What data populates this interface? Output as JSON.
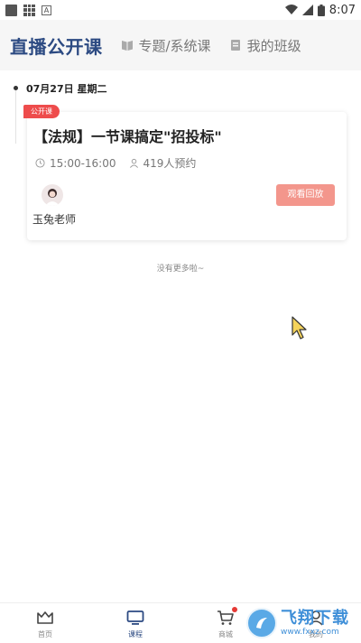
{
  "status_bar": {
    "time": "8:07"
  },
  "header": {
    "title": "直播公开课",
    "tabs": [
      {
        "label": "专题/系统课",
        "icon": "book-icon"
      },
      {
        "label": "我的班级",
        "icon": "notebook-icon"
      }
    ]
  },
  "timeline": {
    "date": "07月27日 星期二"
  },
  "course_card": {
    "badge": "公开课",
    "title": "【法规】一节课搞定\"招投标\"",
    "time": "15:00-16:00",
    "reservations": "419人预约",
    "teacher": "玉兔老师",
    "action": "观看回放"
  },
  "list_footer": "没有更多啦~",
  "bottom_nav": {
    "items": [
      {
        "label": "首页",
        "icon": "crown-icon"
      },
      {
        "label": "课程",
        "icon": "tv-icon"
      },
      {
        "label": "商城",
        "icon": "cart-icon"
      },
      {
        "label": "我的",
        "icon": "user-icon"
      }
    ]
  },
  "watermark": {
    "text": "飞翔下载",
    "url": "www.fxxz.com"
  },
  "colors": {
    "accent": "#2c4a82",
    "badge": "#ee4c4c",
    "button": "#f3968c"
  }
}
